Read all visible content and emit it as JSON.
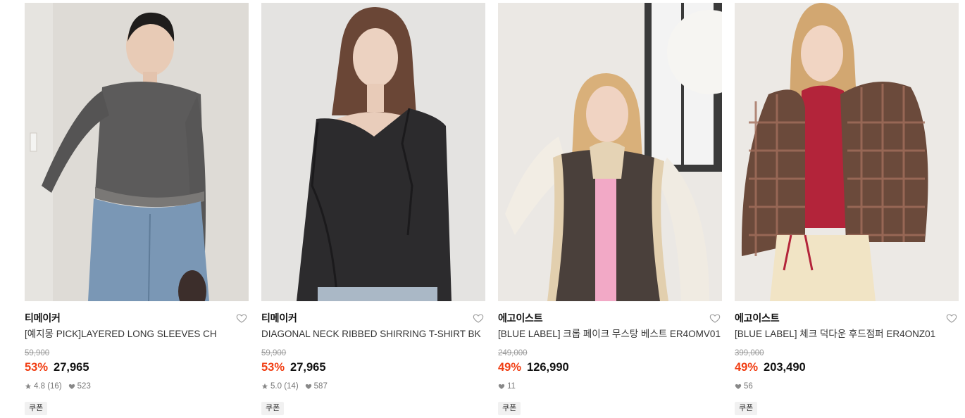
{
  "products": [
    {
      "brand": "티메이커",
      "name": "[예지몽 PICK]LAYERED LONG SLEEVES CH",
      "original_price": "59,900",
      "discount": "53%",
      "price": "27,965",
      "rating": "4.8",
      "review_count": "(16)",
      "likes": "523",
      "coupon": "쿠폰",
      "image_alt": "Model in grey layered long sleeve top and light blue jeans"
    },
    {
      "brand": "티메이커",
      "name": "DIAGONAL NECK RIBBED SHIRRING T-SHIRT BK",
      "original_price": "59,900",
      "discount": "53%",
      "price": "27,965",
      "rating": "5.0",
      "review_count": "(14)",
      "likes": "587",
      "coupon": "쿠폰",
      "image_alt": "Model in black diagonal neck ribbed shirring t-shirt"
    },
    {
      "brand": "에고이스트",
      "name": "[BLUE LABEL] 크롭 페이크 무스탕 베스트 ER4OMV01",
      "original_price": "249,000",
      "discount": "49%",
      "price": "126,990",
      "rating": null,
      "review_count": null,
      "likes": "11",
      "coupon": "쿠폰",
      "image_alt": "Model in cropped brown faux mustang vest with shearling trim"
    },
    {
      "brand": "에고이스트",
      "name": "[BLUE LABEL] 체크 덕다운 후드점퍼 ER4ONZ01",
      "original_price": "399,000",
      "discount": "49%",
      "price": "203,490",
      "rating": null,
      "review_count": null,
      "likes": "56",
      "coupon": "쿠폰",
      "image_alt": "Model in plaid check duck down hooded puffer jacket"
    }
  ],
  "colors": {
    "discount": "#f13e13",
    "original_price": "#9a9a9a",
    "coupon_bg": "#f1f1f1"
  },
  "icons": {
    "wishlist": "heart-outline-icon",
    "rating": "star-icon",
    "likes": "heart-filled-icon"
  }
}
